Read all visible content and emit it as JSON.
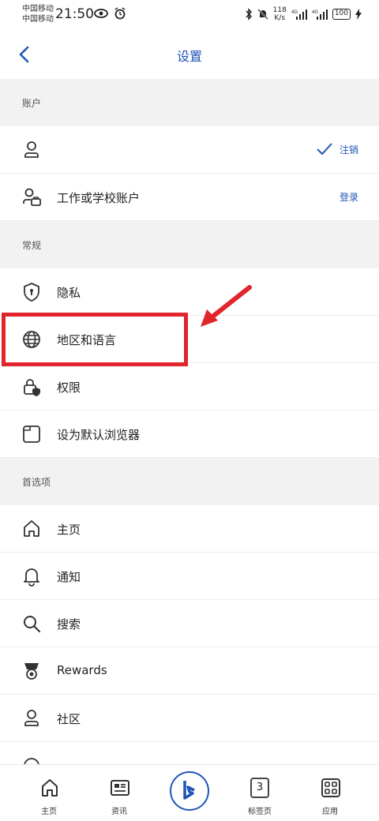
{
  "status": {
    "carrier1": "中国移动",
    "carrier2": "中国移动",
    "time": "21:50",
    "net_speed_value": "118",
    "net_speed_unit": "K/s",
    "battery": "100"
  },
  "header": {
    "title": "设置"
  },
  "sections": {
    "account": "账户",
    "general": "常规",
    "preferences": "首选项"
  },
  "account_rows": {
    "signout_label": "注销",
    "work_school": "工作或学校账户",
    "login_label": "登录"
  },
  "general_rows": {
    "privacy": "隐私",
    "region_language": "地区和语言",
    "permissions": "权限",
    "default_browser": "设为默认浏览器"
  },
  "pref_rows": {
    "home": "主页",
    "notifications": "通知",
    "search": "搜索",
    "rewards": "Rewards",
    "community": "社区"
  },
  "bottom_nav": {
    "home": "主页",
    "news": "资讯",
    "tabs_count": "3",
    "tabs": "标签页",
    "apps": "应用"
  },
  "colors": {
    "accent": "#1f56b8",
    "annotation": "#e0252c"
  }
}
